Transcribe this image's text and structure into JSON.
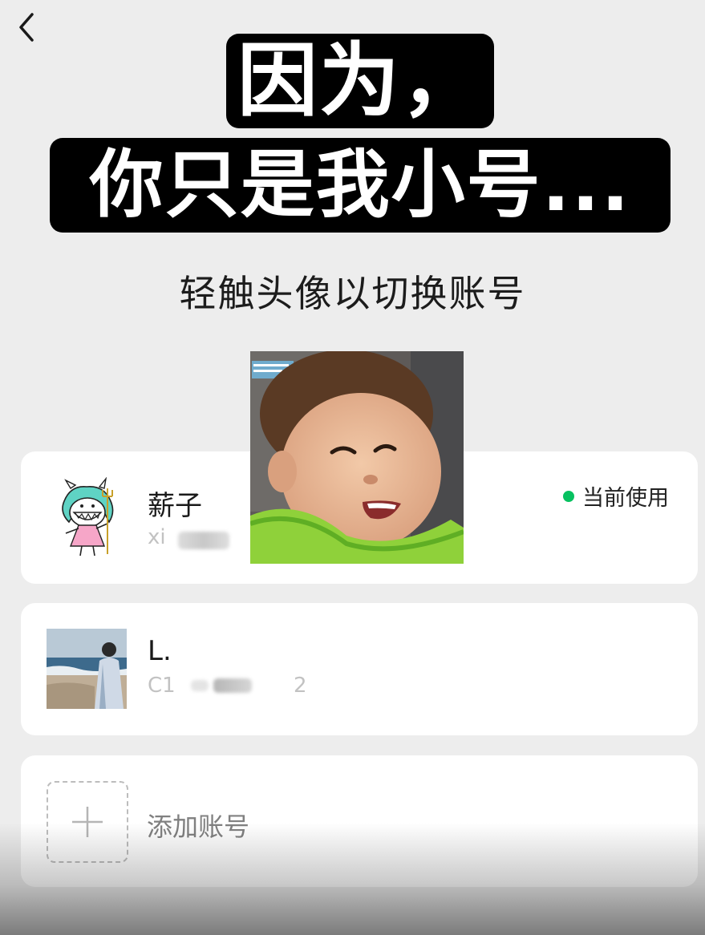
{
  "header": {
    "back_icon": "chevron-left-icon"
  },
  "captions": {
    "line1": "因为，",
    "line2": "你只是我小号..."
  },
  "subtitle": "轻触头像以切换账号",
  "accounts": [
    {
      "name": "薪子",
      "id_visible": "xi",
      "status": "当前使用",
      "status_color": "#07c160",
      "avatar": "doodle-character-avatar"
    },
    {
      "name": "L.",
      "id_visible_start": "C1",
      "id_visible_end": "2",
      "avatar": "beach-photo-avatar"
    }
  ],
  "add_account": {
    "label": "添加账号",
    "icon": "plus-icon"
  },
  "overlay": {
    "sticker": "laughing-baby-sticker"
  },
  "colors": {
    "background": "#ededed",
    "card": "#ffffff",
    "accent_green": "#07c160"
  }
}
